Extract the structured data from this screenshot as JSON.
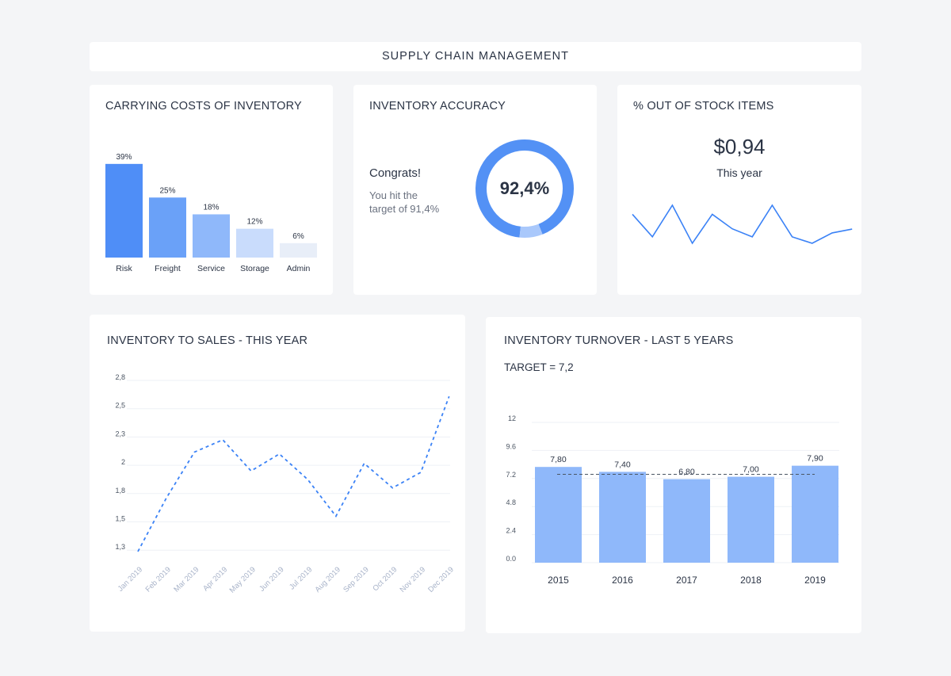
{
  "header": {
    "title": "SUPPLY CHAIN MANAGEMENT"
  },
  "carrying": {
    "title": "CARRYING COSTS OF INVENTORY",
    "chart_data": {
      "type": "bar",
      "categories": [
        "Risk",
        "Freight",
        "Service",
        "Storage",
        "Admin"
      ],
      "values": [
        39,
        25,
        18,
        12,
        6
      ],
      "labels": [
        "39%",
        "25%",
        "18%",
        "12%",
        "6%"
      ],
      "colors": [
        "#4f8ef7",
        "#6aa1f8",
        "#8fb8fa",
        "#c9dcfc",
        "#e8eef8"
      ]
    }
  },
  "accuracy": {
    "title": "INVENTORY ACCURACY",
    "congrats": "Congrats!",
    "line1": "You hit the",
    "line2": "target of 91,4%",
    "value_label": "92,4%",
    "chart_data": {
      "type": "pie",
      "values": [
        92.4,
        7.6
      ],
      "colors": [
        "#5391f5",
        "#a9c8fb"
      ]
    }
  },
  "stock": {
    "title": "% OUT OF STOCK ITEMS",
    "value": "$0,94",
    "period": "This year",
    "chart_data": {
      "type": "line",
      "values": [
        112,
        25,
        147,
        0,
        112,
        56,
        25,
        147,
        25,
        0,
        40,
        55
      ],
      "color": "#3b82f6"
    }
  },
  "sales": {
    "title": "INVENTORY TO SALES - THIS YEAR",
    "chart_data": {
      "type": "line",
      "x": [
        "Jan 2019",
        "Feb 2019",
        "Mar 2019",
        "Apr 2019",
        "May 2019",
        "Jun 2019",
        "Jul 2019",
        "Aug 2019",
        "Sep 2019",
        "Oct 2019",
        "Nov 2019",
        "Dec 2019"
      ],
      "y": [
        1.29,
        1.75,
        2.14,
        2.27,
        1.96,
        2.12,
        1.9,
        1.56,
        2.02,
        1.84,
        1.95,
        2.63
      ],
      "yticks": [
        "2,8",
        "2,5",
        "2,3",
        "2",
        "1,8",
        "1,5",
        "1,3"
      ],
      "ytick_values": [
        2.8,
        2.5,
        2.3,
        2.0,
        1.8,
        1.5,
        1.3
      ],
      "grid": true,
      "line_style": "dashed",
      "color": "#3b82f6"
    }
  },
  "turnover": {
    "title": "INVENTORY TURNOVER - LAST 5 YEARS",
    "target_label": "TARGET = 7,2",
    "chart_data": {
      "type": "bar",
      "categories": [
        "2015",
        "2016",
        "2017",
        "2018",
        "2019"
      ],
      "values": [
        7.8,
        7.4,
        6.8,
        7.0,
        7.9
      ],
      "labels": [
        "7,80",
        "7,40",
        "6,80",
        "7,00",
        "7,90"
      ],
      "yticks": [
        "12",
        "9.6",
        "7.2",
        "4.8",
        "2.4",
        "0.0"
      ],
      "ylim": [
        0,
        12
      ],
      "target": 7.2,
      "grid": true,
      "color": "#8fb8fa"
    }
  }
}
